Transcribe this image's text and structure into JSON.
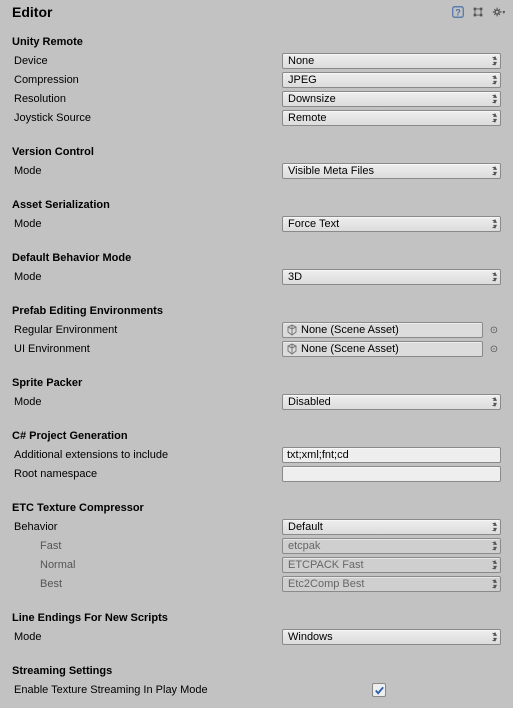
{
  "header": {
    "title": "Editor"
  },
  "unity_remote": {
    "title": "Unity Remote",
    "device_label": "Device",
    "device_value": "None",
    "compression_label": "Compression",
    "compression_value": "JPEG",
    "resolution_label": "Resolution",
    "resolution_value": "Downsize",
    "joystick_label": "Joystick Source",
    "joystick_value": "Remote"
  },
  "version_control": {
    "title": "Version Control",
    "mode_label": "Mode",
    "mode_value": "Visible Meta Files"
  },
  "asset_serialization": {
    "title": "Asset Serialization",
    "mode_label": "Mode",
    "mode_value": "Force Text"
  },
  "default_behavior": {
    "title": "Default Behavior Mode",
    "mode_label": "Mode",
    "mode_value": "3D"
  },
  "prefab_env": {
    "title": "Prefab Editing Environments",
    "regular_label": "Regular Environment",
    "regular_value": "None (Scene Asset)",
    "ui_label": "UI Environment",
    "ui_value": "None (Scene Asset)"
  },
  "sprite_packer": {
    "title": "Sprite Packer",
    "mode_label": "Mode",
    "mode_value": "Disabled"
  },
  "csharp_gen": {
    "title": "C# Project Generation",
    "ext_label": "Additional extensions to include",
    "ext_value": "txt;xml;fnt;cd",
    "ns_label": "Root namespace",
    "ns_value": ""
  },
  "etc": {
    "title": "ETC Texture Compressor",
    "behavior_label": "Behavior",
    "behavior_value": "Default",
    "fast_label": "Fast",
    "fast_value": "etcpak",
    "normal_label": "Normal",
    "normal_value": "ETCPACK Fast",
    "best_label": "Best",
    "best_value": "Etc2Comp Best"
  },
  "line_endings": {
    "title": "Line Endings For New Scripts",
    "mode_label": "Mode",
    "mode_value": "Windows"
  },
  "streaming": {
    "title": "Streaming Settings",
    "enable_label": "Enable Texture Streaming In Play Mode",
    "enable_value": true
  }
}
